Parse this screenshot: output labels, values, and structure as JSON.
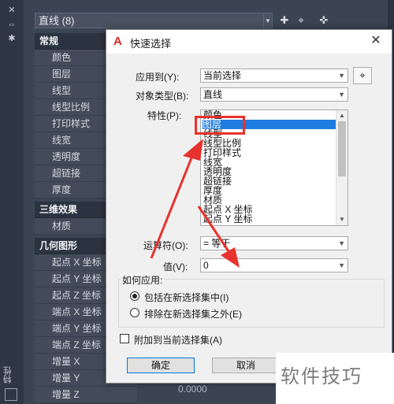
{
  "palette": {
    "selector_value": "直线 (8)",
    "vertical_label": "特性",
    "sections": {
      "general": "常规",
      "three_d": "三维效果",
      "geometry": "几何图形"
    },
    "general_rows": [
      "颜色",
      "图层",
      "线型",
      "线型比例",
      "打印样式",
      "线宽",
      "透明度",
      "超链接",
      "厚度"
    ],
    "three_d_rows": [
      "材质"
    ],
    "geometry_rows": [
      "起点 X 坐标",
      "起点 Y 坐标",
      "起点 Z 坐标",
      "端点 X 坐标",
      "端点 Y 坐标",
      "端点 Z 坐标",
      "增量 X",
      "增量 Y",
      "增量 Z"
    ],
    "delta_z_value": "0.0000"
  },
  "dialog": {
    "title": "快速选择",
    "apply_to_label": "应用到(Y):",
    "apply_to_value": "当前选择",
    "object_type_label": "对象类型(B):",
    "object_type_value": "直线",
    "properties_label": "特性(P):",
    "properties_list": [
      "颜色",
      "图层",
      "线型",
      "线型比例",
      "打印样式",
      "线宽",
      "透明度",
      "超链接",
      "厚度",
      "材质",
      "起点 X 坐标",
      "起点 Y 坐标"
    ],
    "selected_property": "图层",
    "operator_label": "运算符(O):",
    "operator_value": "= 等于",
    "value_label": "值(V):",
    "value_value": "0",
    "how_to_apply_title": "如何应用:",
    "radio_include": "包括在新选择集中(I)",
    "radio_exclude": "排除在新选择集之外(E)",
    "append_checkbox": "附加到当前选择集(A)",
    "ok_button": "确定",
    "cancel_button": "取消"
  },
  "watermark": "软件技巧",
  "colors": {
    "highlight": "#1e7be0",
    "annotation_red": "#e8322d",
    "palette_bg": "#3b4453"
  }
}
